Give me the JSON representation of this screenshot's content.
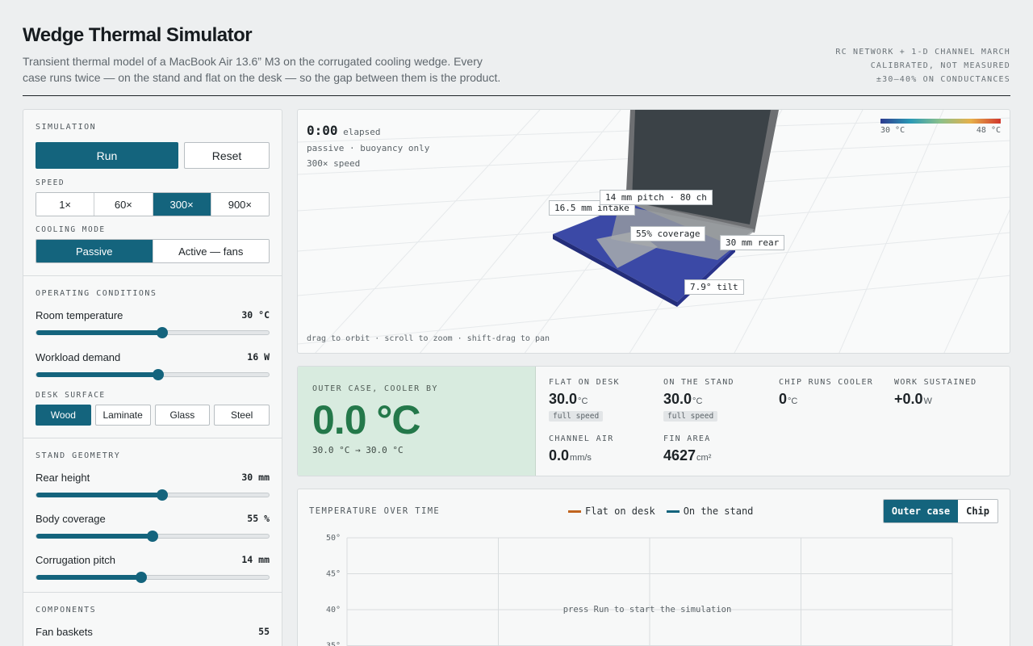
{
  "header": {
    "title": "Wedge Thermal Simulator",
    "subtitle": "Transient thermal model of a MacBook Air 13.6” M3 on the corrugated cooling wedge. Every case runs twice — on the stand and flat on the desk — so the gap between them is the product.",
    "meta": [
      "RC NETWORK + 1-D CHANNEL MARCH",
      "CALIBRATED, NOT MEASURED",
      "±30–40% ON CONDUCTANCES"
    ]
  },
  "simulation": {
    "title": "SIMULATION",
    "run_label": "Run",
    "reset_label": "Reset",
    "speed_label": "SPEED",
    "speeds": [
      "1×",
      "60×",
      "300×",
      "900×"
    ],
    "speed_selected": "300×",
    "cooling_label": "COOLING MODE",
    "cooling_modes": [
      "Passive",
      "Active — fans"
    ],
    "cooling_selected": "Passive"
  },
  "conditions": {
    "title": "OPERATING CONDITIONS",
    "room": {
      "label": "Room temperature",
      "value": "30 °C",
      "fraction": 0.54
    },
    "workload": {
      "label": "Workload demand",
      "value": "16 W",
      "fraction": 0.525
    },
    "surface_label": "DESK SURFACE",
    "surfaces": [
      "Wood",
      "Laminate",
      "Glass",
      "Steel"
    ],
    "surface_selected": "Wood"
  },
  "geometry": {
    "title": "STAND GEOMETRY",
    "rear": {
      "label": "Rear height",
      "value": "30 mm",
      "fraction": 0.54
    },
    "coverage": {
      "label": "Body coverage",
      "value": "55 %",
      "fraction": 0.5
    },
    "pitch": {
      "label": "Corrugation pitch",
      "value": "14 mm",
      "fraction": 0.45
    }
  },
  "components": {
    "title": "COMPONENTS",
    "first_item_label": "Fan baskets",
    "first_item_value": "55"
  },
  "view": {
    "elapsed_time": "0:00",
    "elapsed_label": "elapsed",
    "mode_line": "passive · buoyancy only",
    "speed_line": "300× speed",
    "hint": "drag to orbit · scroll to zoom · shift-drag to pan",
    "scale_min": "30 °C",
    "scale_max": "48 °C",
    "tags": {
      "pitch": "14 mm pitch · 80 ch",
      "intake": "16.5 mm intake",
      "coverage": "55% coverage",
      "rear": "30 mm rear",
      "tilt": "7.9° tilt"
    }
  },
  "metrics": {
    "cooler_label": "OUTER CASE, COOLER BY",
    "cooler_value": "0.0 °C",
    "cooler_range": "30.0 °C → 30.0 °C",
    "flat": {
      "label": "FLAT ON DESK",
      "value": "30.0",
      "unit": "°C",
      "badge": "full speed"
    },
    "stand": {
      "label": "ON THE STAND",
      "value": "30.0",
      "unit": "°C",
      "badge": "full speed"
    },
    "chip": {
      "label": "CHIP RUNS COOLER",
      "value": "0",
      "unit": "°C"
    },
    "work": {
      "label": "WORK SUSTAINED",
      "value": "+0.0",
      "unit": "W"
    },
    "air": {
      "label": "CHANNEL AIR",
      "value": "0.0",
      "unit": "mm/s"
    },
    "fin": {
      "label": "FIN AREA",
      "value": "4627",
      "unit": "cm²"
    }
  },
  "chart_data": {
    "type": "line",
    "title": "TEMPERATURE OVER TIME",
    "series": [
      {
        "name": "Flat on desk",
        "color": "#c0641f",
        "values": []
      },
      {
        "name": "On the stand",
        "color": "#14647d",
        "values": []
      }
    ],
    "y_ticks": [
      "50°",
      "45°",
      "40°",
      "35°"
    ],
    "ylim": [
      30,
      50
    ],
    "grid": true,
    "legend": "top-center",
    "empty_message": "press Run to start the simulation",
    "toggle": [
      "Outer case",
      "Chip"
    ],
    "toggle_selected": "Outer case"
  },
  "colors": {
    "accent": "#14647d",
    "cool": "#24784a",
    "flat_series": "#c0641f"
  }
}
